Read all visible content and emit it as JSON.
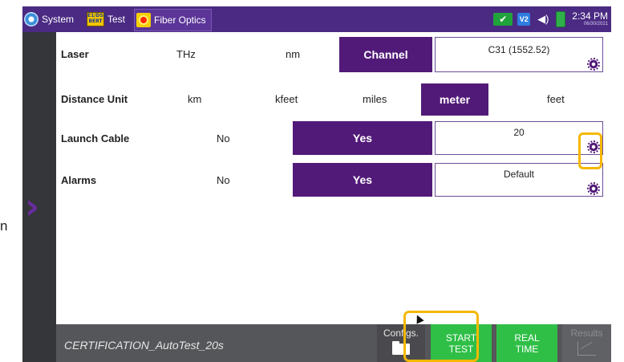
{
  "header": {
    "tabs": [
      {
        "label": "System",
        "icon": "system-gear-icon"
      },
      {
        "label": "Test",
        "icon": "bert-icon",
        "icon_text": "E1/DS1 BERT"
      },
      {
        "label": "Fiber Optics",
        "icon": "laser-icon"
      }
    ],
    "status": {
      "v_label": "V2",
      "time": "2:34 PM",
      "date": "06/30/2021"
    }
  },
  "settings": {
    "laser": {
      "label": "Laser",
      "options": [
        "THz",
        "nm",
        "Channel"
      ],
      "selected": "Channel",
      "value": "C31 (1552.52)"
    },
    "distance": {
      "label": "Distance Unit",
      "options": [
        "km",
        "kfeet",
        "miles",
        "meter",
        "feet"
      ],
      "selected": "meter"
    },
    "launch": {
      "label": "Launch Cable",
      "no": "No",
      "yes": "Yes",
      "selected": "Yes",
      "value": "20"
    },
    "alarms": {
      "label": "Alarms",
      "no": "No",
      "yes": "Yes",
      "selected": "Yes",
      "value": "Default"
    }
  },
  "footer": {
    "config_name": "CERTIFICATION_AutoTest_20s",
    "configs_label": "Configs.",
    "start": [
      "START",
      "TEST"
    ],
    "realtime": [
      "REAL",
      "TIME"
    ],
    "results_label": "Results"
  },
  "left_fragment": "n",
  "colors": {
    "header": "#4a2a82",
    "selected": "#521a78",
    "green": "#2fbf47",
    "highlight": "#f5b800",
    "sidebar": "#35363a"
  }
}
